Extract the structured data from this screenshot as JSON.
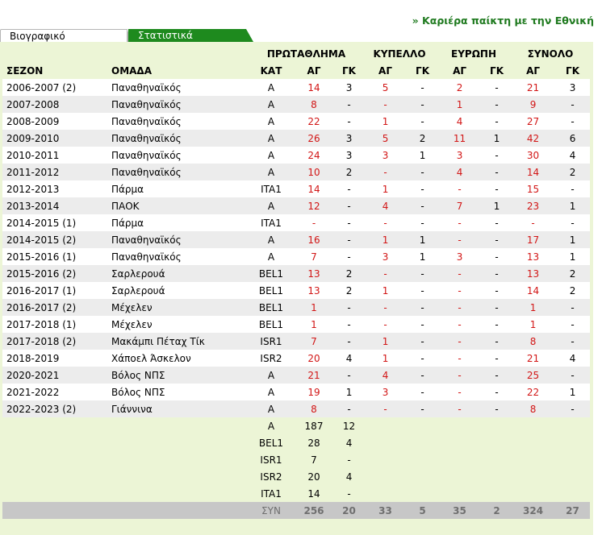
{
  "career_link": "» Καριέρα παίκτη με την Εθνική",
  "tabs": {
    "bio": "Βιογραφικό",
    "stats": "Στατιστικά"
  },
  "headers": {
    "groups": {
      "league": "ΠΡΩΤΑΘΛΗΜΑ",
      "cup": "ΚΥΠΕΛΛΟ",
      "europe": "ΕΥΡΩΠΗ",
      "total": "ΣΥΝΟΛΟ"
    },
    "season": "ΣΕΖΟΝ",
    "team": "ΟΜΑΔΑ",
    "cat": "ΚΑΤ",
    "ag": "ΑΓ",
    "gk": "ΓΚ"
  },
  "rows": [
    {
      "season": "2006-2007 (2)",
      "team": "Παναθηναϊκός",
      "cat": "A",
      "lag": "14",
      "lgk": "3",
      "cag": "5",
      "cgk": "-",
      "eag": "2",
      "egk": "-",
      "tag": "21",
      "tgk": "3"
    },
    {
      "season": "2007-2008",
      "team": "Παναθηναϊκός",
      "cat": "A",
      "lag": "8",
      "lgk": "-",
      "cag": "-",
      "cgk": "-",
      "eag": "1",
      "egk": "-",
      "tag": "9",
      "tgk": "-"
    },
    {
      "season": "2008-2009",
      "team": "Παναθηναϊκός",
      "cat": "A",
      "lag": "22",
      "lgk": "-",
      "cag": "1",
      "cgk": "-",
      "eag": "4",
      "egk": "-",
      "tag": "27",
      "tgk": "-"
    },
    {
      "season": "2009-2010",
      "team": "Παναθηναϊκός",
      "cat": "A",
      "lag": "26",
      "lgk": "3",
      "cag": "5",
      "cgk": "2",
      "eag": "11",
      "egk": "1",
      "tag": "42",
      "tgk": "6"
    },
    {
      "season": "2010-2011",
      "team": "Παναθηναϊκός",
      "cat": "A",
      "lag": "24",
      "lgk": "3",
      "cag": "3",
      "cgk": "1",
      "eag": "3",
      "egk": "-",
      "tag": "30",
      "tgk": "4"
    },
    {
      "season": "2011-2012",
      "team": "Παναθηναϊκός",
      "cat": "A",
      "lag": "10",
      "lgk": "2",
      "cag": "-",
      "cgk": "-",
      "eag": "4",
      "egk": "-",
      "tag": "14",
      "tgk": "2"
    },
    {
      "season": "2012-2013",
      "team": "Πάρμα",
      "cat": "ITA1",
      "lag": "14",
      "lgk": "-",
      "cag": "1",
      "cgk": "-",
      "eag": "-",
      "egk": "-",
      "tag": "15",
      "tgk": "-"
    },
    {
      "season": "2013-2014",
      "team": "ΠΑΟΚ",
      "cat": "A",
      "lag": "12",
      "lgk": "-",
      "cag": "4",
      "cgk": "-",
      "eag": "7",
      "egk": "1",
      "tag": "23",
      "tgk": "1"
    },
    {
      "season": "2014-2015 (1)",
      "team": "Πάρμα",
      "cat": "ITA1",
      "lag": "-",
      "lgk": "-",
      "cag": "-",
      "cgk": "-",
      "eag": "-",
      "egk": "-",
      "tag": "-",
      "tgk": "-"
    },
    {
      "season": "2014-2015 (2)",
      "team": "Παναθηναϊκός",
      "cat": "A",
      "lag": "16",
      "lgk": "-",
      "cag": "1",
      "cgk": "1",
      "eag": "-",
      "egk": "-",
      "tag": "17",
      "tgk": "1"
    },
    {
      "season": "2015-2016 (1)",
      "team": "Παναθηναϊκός",
      "cat": "A",
      "lag": "7",
      "lgk": "-",
      "cag": "3",
      "cgk": "1",
      "eag": "3",
      "egk": "-",
      "tag": "13",
      "tgk": "1"
    },
    {
      "season": "2015-2016 (2)",
      "team": "Σαρλερουά",
      "cat": "BEL1",
      "lag": "13",
      "lgk": "2",
      "cag": "-",
      "cgk": "-",
      "eag": "-",
      "egk": "-",
      "tag": "13",
      "tgk": "2"
    },
    {
      "season": "2016-2017 (1)",
      "team": "Σαρλερουά",
      "cat": "BEL1",
      "lag": "13",
      "lgk": "2",
      "cag": "1",
      "cgk": "-",
      "eag": "-",
      "egk": "-",
      "tag": "14",
      "tgk": "2"
    },
    {
      "season": "2016-2017 (2)",
      "team": "Μέχελεν",
      "cat": "BEL1",
      "lag": "1",
      "lgk": "-",
      "cag": "-",
      "cgk": "-",
      "eag": "-",
      "egk": "-",
      "tag": "1",
      "tgk": "-"
    },
    {
      "season": "2017-2018 (1)",
      "team": "Μέχελεν",
      "cat": "BEL1",
      "lag": "1",
      "lgk": "-",
      "cag": "-",
      "cgk": "-",
      "eag": "-",
      "egk": "-",
      "tag": "1",
      "tgk": "-"
    },
    {
      "season": "2017-2018 (2)",
      "team": "Μακάμπι Πέταχ Τίκ",
      "cat": "ISR1",
      "lag": "7",
      "lgk": "-",
      "cag": "1",
      "cgk": "-",
      "eag": "-",
      "egk": "-",
      "tag": "8",
      "tgk": "-"
    },
    {
      "season": "2018-2019",
      "team": "Χάποελ Άσκελον",
      "cat": "ISR2",
      "lag": "20",
      "lgk": "4",
      "cag": "1",
      "cgk": "-",
      "eag": "-",
      "egk": "-",
      "tag": "21",
      "tgk": "4"
    },
    {
      "season": "2020-2021",
      "team": "Βόλος ΝΠΣ",
      "cat": "A",
      "lag": "21",
      "lgk": "-",
      "cag": "4",
      "cgk": "-",
      "eag": "-",
      "egk": "-",
      "tag": "25",
      "tgk": "-"
    },
    {
      "season": "2021-2022",
      "team": "Βόλος ΝΠΣ",
      "cat": "A",
      "lag": "19",
      "lgk": "1",
      "cag": "3",
      "cgk": "-",
      "eag": "-",
      "egk": "-",
      "tag": "22",
      "tgk": "1"
    },
    {
      "season": "2022-2023 (2)",
      "team": "Γιάννινα",
      "cat": "A",
      "lag": "8",
      "lgk": "-",
      "cag": "-",
      "cgk": "-",
      "eag": "-",
      "egk": "-",
      "tag": "8",
      "tgk": "-"
    }
  ],
  "category_totals": [
    {
      "cat": "A",
      "ag": "187",
      "gk": "12"
    },
    {
      "cat": "BEL1",
      "ag": "28",
      "gk": "4"
    },
    {
      "cat": "ISR1",
      "ag": "7",
      "gk": "-"
    },
    {
      "cat": "ISR2",
      "ag": "20",
      "gk": "4"
    },
    {
      "cat": "ITA1",
      "ag": "14",
      "gk": "-"
    }
  ],
  "totals": {
    "label": "ΣΥΝ",
    "lag": "256",
    "lgk": "20",
    "cag": "33",
    "cgk": "5",
    "eag": "35",
    "egk": "2",
    "tag": "324",
    "tgk": "27"
  },
  "colors": {
    "accent_green": "#1e8a1e",
    "panel_bg": "#ecf5d6",
    "value_red": "#d21616",
    "stripe": "#ececec",
    "total_bar": "#c7c7c7"
  }
}
